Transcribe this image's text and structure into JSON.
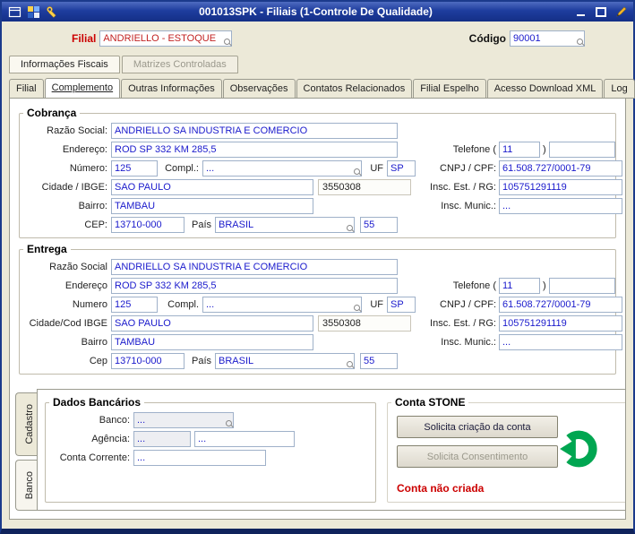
{
  "window": {
    "title": "001013SPK - Filiais (1-Controle De Qualidade)"
  },
  "icons": {
    "window": "window-frame",
    "app_logo": "colored-squares",
    "wrench": "wrench",
    "minimize": "–",
    "maximize": "❐",
    "pencil": "✎",
    "lookup": "magnifier",
    "stone_status": "green-ring-left-arrow"
  },
  "colors": {
    "titlebar": "#1e3d9e",
    "field_text": "#1a1acc",
    "alert_red": "#cc0000",
    "stone_green": "#00a651"
  },
  "header": {
    "filial_label": "Filial",
    "filial_value": "ANDRIELLO - ESTOQUE",
    "codigo_label": "Código",
    "codigo_value": "90001"
  },
  "tabs_top": {
    "informacoes_fiscais": "Informações Fiscais",
    "matrizes_controladas": "Matrizes Controladas"
  },
  "tabs_main": [
    "Filial",
    "Complemento",
    "Outras Informações",
    "Observações",
    "Contatos Relacionados",
    "Filial Espelho",
    "Acesso Download XML",
    "Log"
  ],
  "cobranca": {
    "title": "Cobrança",
    "labels": {
      "razao_social": "Razão Social:",
      "endereco": "Endereço:",
      "numero": "Número:",
      "compl": "Compl.:",
      "uf": "UF",
      "cidade": "Cidade / IBGE:",
      "bairro": "Bairro:",
      "cep": "CEP:",
      "pais": "País",
      "telefone_open": "Telefone (",
      "telefone_close": ")",
      "cnpj": "CNPJ / CPF:",
      "insc_est": "Insc. Est. / RG:",
      "insc_mun": "Insc. Munic.:"
    },
    "values": {
      "razao_social": "ANDRIELLO SA INDUSTRIA E COMERCIO",
      "endereco": "ROD SP 332 KM 285,5",
      "numero": "125",
      "compl": "...",
      "uf": "SP",
      "cidade": "SAO PAULO",
      "ibge": "3550308",
      "bairro": "TAMBAU",
      "cep": "13710-000",
      "pais": "BRASIL",
      "ddi": "55",
      "ddd": "11",
      "telefone": "",
      "cnpj": "61.508.727/0001-79",
      "insc_est": "105751291119",
      "insc_mun": "..."
    }
  },
  "entrega": {
    "title": "Entrega",
    "labels": {
      "razao_social": "Razão Social",
      "endereco": "Endereço",
      "numero": "Numero",
      "compl": "Compl.",
      "uf": "UF",
      "cidade": "Cidade/Cod IBGE",
      "bairro": "Bairro",
      "cep": "Cep",
      "pais": "País",
      "telefone_open": "Telefone (",
      "telefone_close": ")",
      "cnpj": "CNPJ / CPF:",
      "insc_est": "Insc. Est. / RG:",
      "insc_mun": "Insc. Munic.:"
    },
    "values": {
      "razao_social": "ANDRIELLO SA INDUSTRIA E COMERCIO",
      "endereco": "ROD SP 332 KM 285,5",
      "numero": "125",
      "compl": "...",
      "uf": "SP",
      "cidade": "SAO PAULO",
      "ibge": "3550308",
      "bairro": "TAMBAU",
      "cep": "13710-000",
      "pais": "BRASIL",
      "ddi": "55",
      "ddd": "11",
      "telefone": "",
      "cnpj": "61.508.727/0001-79",
      "insc_est": "105751291119",
      "insc_mun": "..."
    }
  },
  "vertical_tabs": [
    "Cadastro",
    "Banco"
  ],
  "dados_bancarios": {
    "title": "Dados Bancários",
    "labels": {
      "banco": "Banco:",
      "agencia": "Agência:",
      "conta": "Conta Corrente:"
    },
    "values": {
      "banco": "...",
      "agencia": "...",
      "agencia_dv": "...",
      "conta": "..."
    }
  },
  "conta_stone": {
    "title": "Conta STONE",
    "btn_criacao": "Solicita criação da conta",
    "btn_consentimento": "Solicita Consentimento",
    "status": "Conta não criada"
  }
}
